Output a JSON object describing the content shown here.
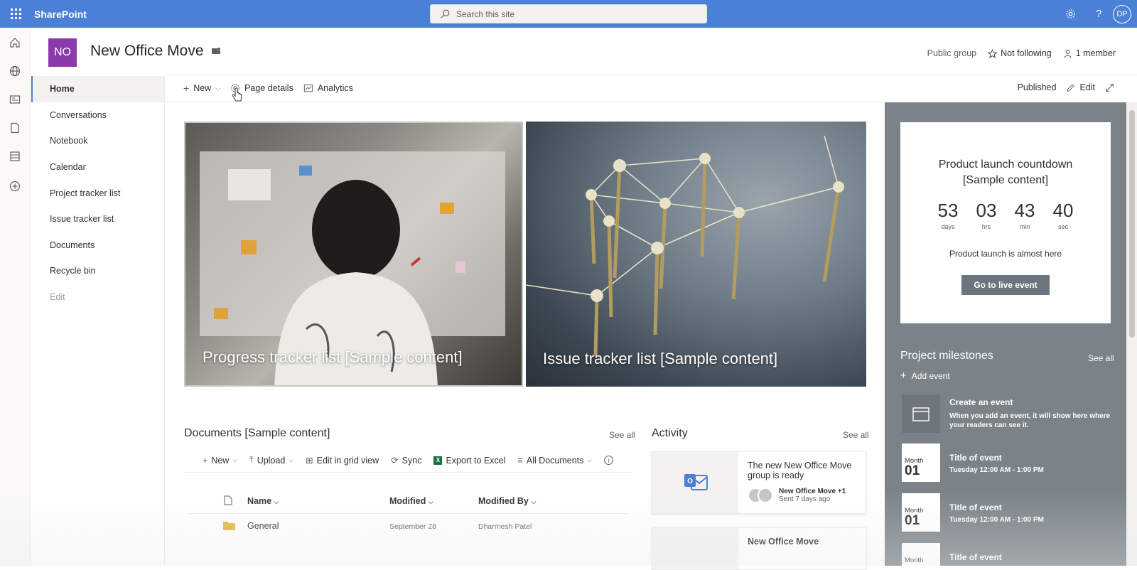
{
  "suite": {
    "brand": "SharePoint",
    "search_placeholder": "Search this site",
    "avatar_initials": "DP"
  },
  "site": {
    "logo_initials": "NO",
    "title": "New Office Move",
    "visibility": "Public group",
    "follow": "Not following",
    "members": "1 member"
  },
  "nav": {
    "items": [
      "Home",
      "Conversations",
      "Notebook",
      "Calendar",
      "Project tracker list",
      "Issue tracker list",
      "Documents",
      "Recycle bin",
      "Edit"
    ]
  },
  "commandbar": {
    "new": "New",
    "page_details": "Page details",
    "analytics": "Analytics",
    "status": "Published",
    "edit": "Edit"
  },
  "hero": {
    "tile1": "Progress tracker list [Sample content]",
    "tile2": "Issue tracker list [Sample content]"
  },
  "documents": {
    "title": "Documents [Sample content]",
    "see_all": "See all",
    "commands": {
      "new": "New",
      "upload": "Upload",
      "edit_grid": "Edit in grid view",
      "sync": "Sync",
      "export": "Export to Excel",
      "view": "All Documents"
    },
    "columns": {
      "name": "Name",
      "modified": "Modified",
      "modified_by": "Modified By"
    },
    "rows": [
      {
        "name": "General",
        "modified": "September 28",
        "modified_by": "Dharmesh Patel"
      }
    ]
  },
  "activity": {
    "title": "Activity",
    "see_all": "See all",
    "cards": [
      {
        "text": "The new New Office Move group is ready",
        "who": "New Office Move +1",
        "when": "Sent 7 days ago"
      },
      {
        "text": "New Office Move"
      }
    ]
  },
  "countdown": {
    "title_line1": "Product launch countdown",
    "title_line2": "[Sample content]",
    "days": "53",
    "days_label": "days",
    "hrs": "03",
    "hrs_label": "hrs",
    "min": "43",
    "min_label": "min",
    "sec": "40",
    "sec_label": "sec",
    "message": "Product launch is almost here",
    "button": "Go to live event"
  },
  "milestones": {
    "title": "Project milestones",
    "see_all": "See all",
    "add": "Add event",
    "create_title": "Create an event",
    "create_sub": "When you add an event, it will show here where your readers can see it.",
    "events": [
      {
        "month": "Month",
        "day": "01",
        "title": "Title of event",
        "time": "Tuesday 12:00 AM - 1:00 PM"
      },
      {
        "month": "Month",
        "day": "01",
        "title": "Title of event",
        "time": "Tuesday 12:00 AM - 1:00 PM"
      },
      {
        "month": "Month",
        "title": "Title of event"
      }
    ]
  }
}
